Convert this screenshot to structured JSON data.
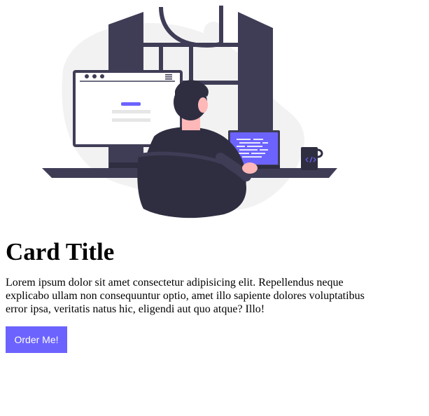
{
  "card": {
    "title": "Card Title",
    "text": "Lorem ipsum dolor sit amet consectetur adipisicing elit. Repellendus neque explicabo ullam non consequuntur optio, amet illo sapiente dolores voluptatibus error ipsa, veritatis natus hic, eligendi aut quo atque? Illo!",
    "button_label": "Order Me!"
  },
  "illustration": {
    "subject": "person-working-at-desk-illustration",
    "colors": {
      "accent": "#6c63ff",
      "dark": "#3f3d56",
      "darker": "#2f2e41",
      "light_gray": "#f2f2f2",
      "skin": "#ffb8b8"
    }
  },
  "colors": {
    "button_bg": "#6c63ff",
    "button_text": "#ffffff"
  }
}
